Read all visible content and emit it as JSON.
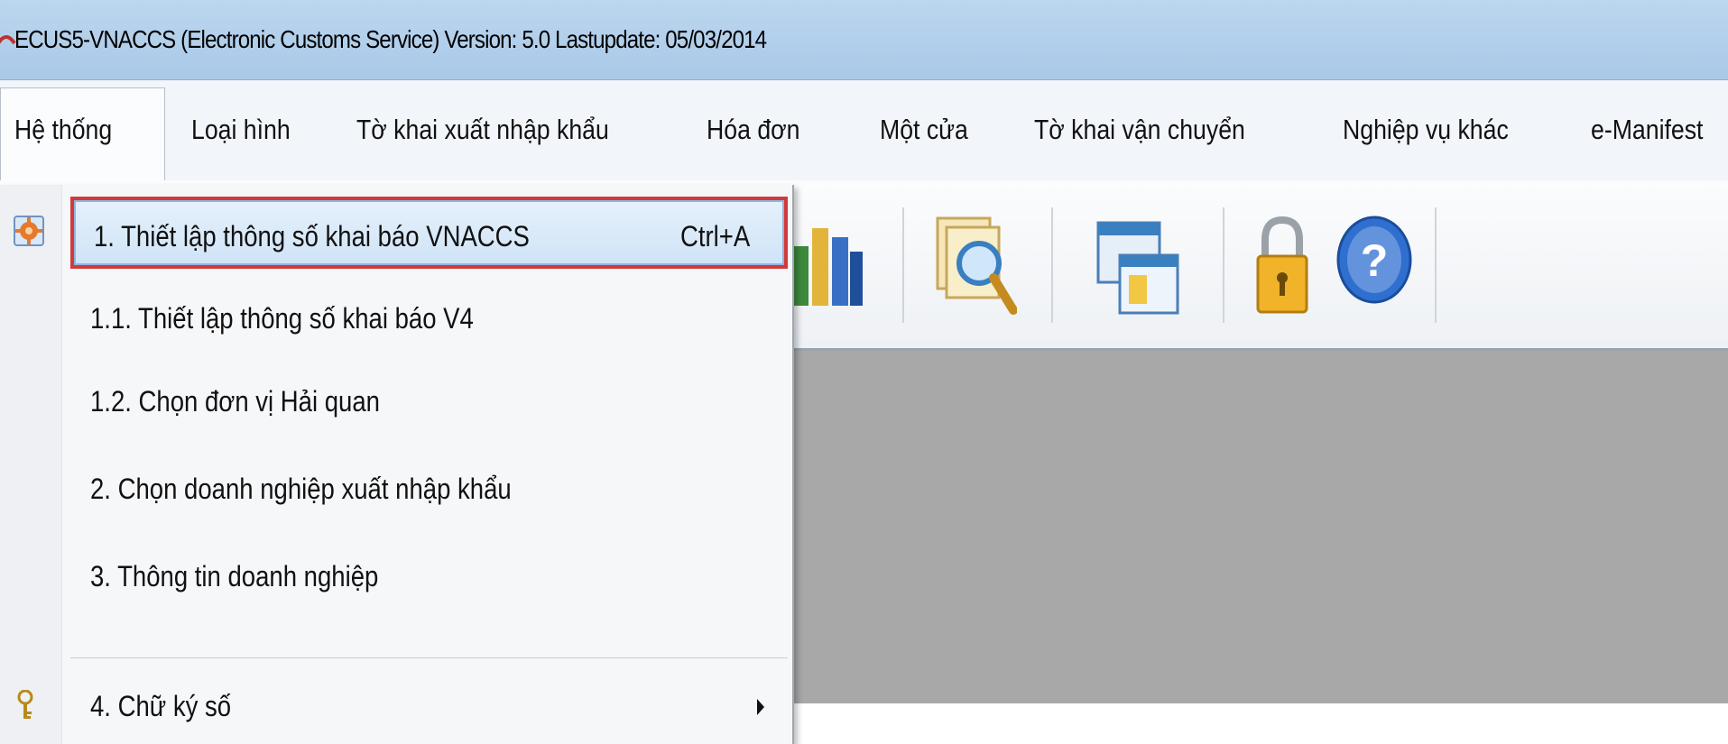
{
  "window": {
    "title": "ECUS5-VNACCS (Electronic Customs Service) Version: 5.0 Lastupdate: 05/03/2014"
  },
  "menubar": {
    "items": [
      {
        "label": "Hệ thống",
        "active": true
      },
      {
        "label": "Loại hình"
      },
      {
        "label": "Tờ khai xuất nhập khẩu"
      },
      {
        "label": "Hóa đơn"
      },
      {
        "label": "Một cửa"
      },
      {
        "label": "Tờ khai vận chuyển"
      },
      {
        "label": "Nghiệp vụ khác"
      },
      {
        "label": "e-Manifest"
      }
    ]
  },
  "toolbar": {
    "icons": [
      "chart-icon",
      "document-search-icon",
      "windows-icon",
      "padlock-icon",
      "help-icon"
    ]
  },
  "dropdown": {
    "items": [
      {
        "label": "1. Thiết lập thông số khai báo VNACCS",
        "shortcut": "Ctrl+A",
        "icon": "settings-gear-icon",
        "highlighted": true
      },
      {
        "label": "1.1. Thiết lập thông số khai báo V4"
      },
      {
        "label": "1.2. Chọn đơn vị Hải quan"
      },
      {
        "label": "2. Chọn doanh nghiệp xuất nhập khẩu"
      },
      {
        "label": "3. Thông tin doanh nghiệp"
      },
      {
        "label": "4. Chữ ký số",
        "icon": "key-icon",
        "submenu": true
      }
    ]
  },
  "colors": {
    "titlebar": "#a9c9e8",
    "highlight_border": "#d23a3a",
    "workspace": "#a8a8a8"
  }
}
